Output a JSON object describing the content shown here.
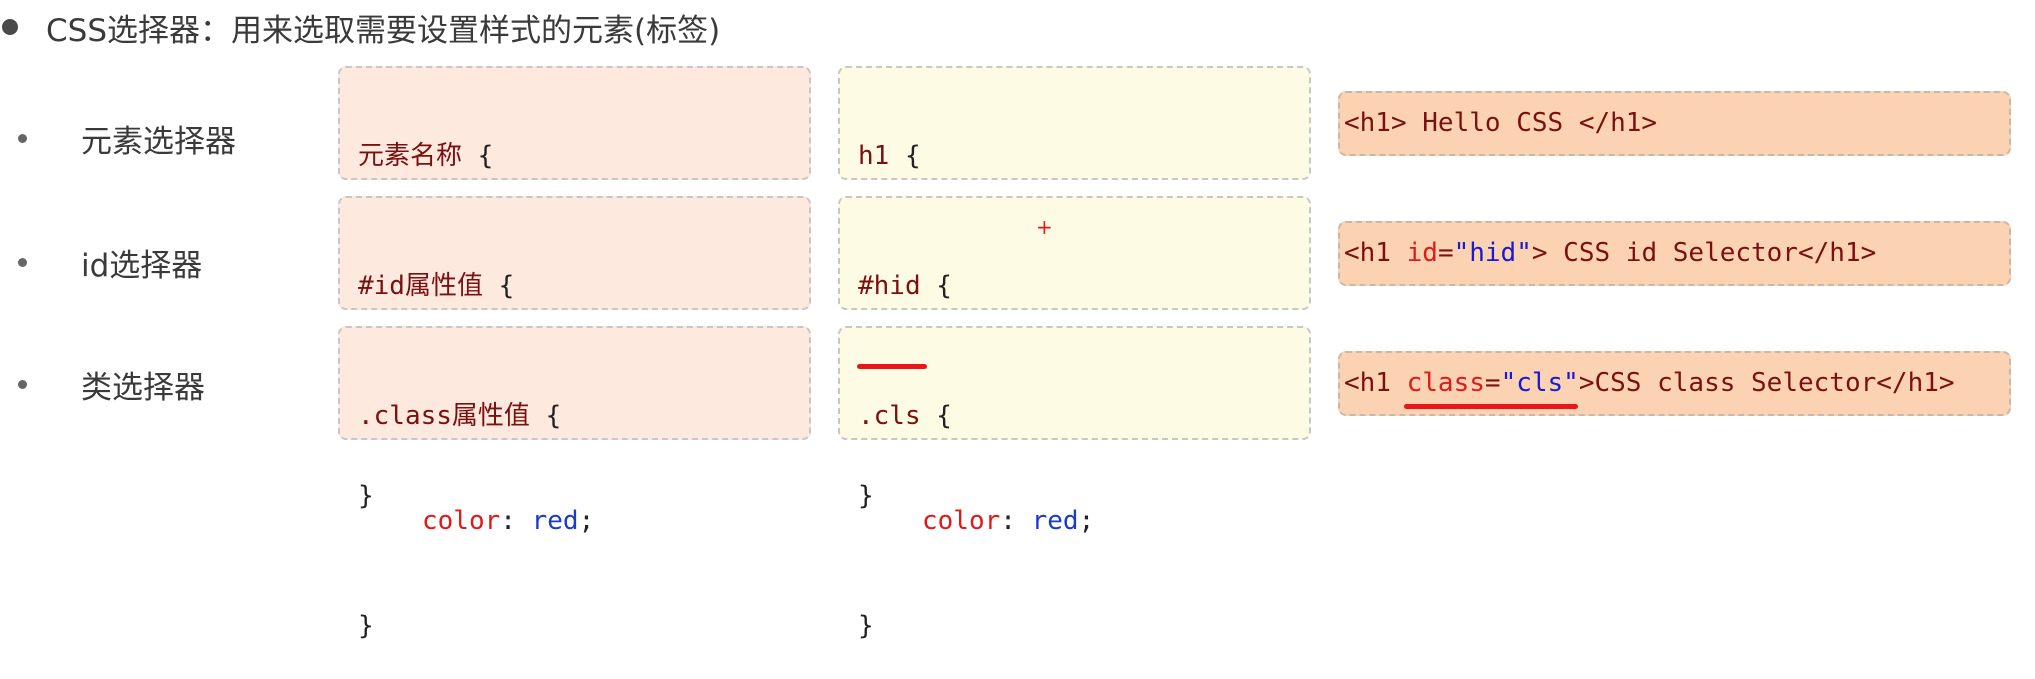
{
  "heading": "CSS选择器：用来选取需要设置样式的元素(标签)",
  "rows": [
    {
      "label": "元素选择器",
      "generic_selector": "元素名称",
      "example_selector": "h1",
      "property": "color",
      "value": "red",
      "html_parts": {
        "open": "<h1>",
        "text": " Hello CSS ",
        "close": "</h1>"
      }
    },
    {
      "label": "id选择器",
      "generic_selector": "#id属性值",
      "example_selector": "#hid",
      "property": "color",
      "value": "red",
      "html_parts": {
        "open": "<h1 ",
        "attr": "id",
        "eq": "=",
        "attrval": "\"hid\"",
        "gt": ">",
        "text": " CSS id Selector",
        "close": "</h1>"
      }
    },
    {
      "label": "类选择器",
      "generic_selector": ".class属性值",
      "example_selector": ".cls",
      "property": "color",
      "value": "red",
      "html_parts": {
        "open": "<h1 ",
        "attr": "class",
        "eq": "=",
        "attrval": "\"cls\"",
        "gt": ">",
        "text": "CSS class Selector",
        "close": "</h1>"
      }
    }
  ],
  "syntax": {
    "open_brace": " {",
    "close_brace": "}",
    "colon": ": ",
    "semicolon": ";"
  },
  "accent_colors": {
    "selector": "#7a1010",
    "property": "#e01a1a",
    "value": "#1a3ad0",
    "underline": "#e8161a"
  },
  "cursor_mark": "+"
}
